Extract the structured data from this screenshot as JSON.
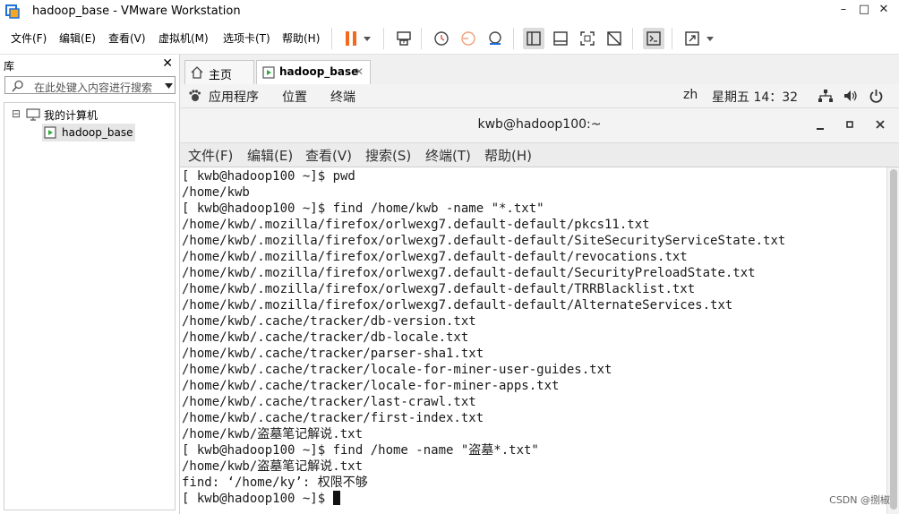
{
  "window": {
    "title": "hadoop_base - VMware Workstation",
    "controls": {
      "minimize": "–",
      "maximize": "□",
      "close": "✕"
    }
  },
  "menubar": {
    "items": [
      "文件(F)",
      "编辑(E)",
      "查看(V)",
      "虚拟机(M)",
      "选项卡(T)",
      "帮助(H)"
    ]
  },
  "library": {
    "title": "库",
    "close": "✕",
    "search_placeholder": "在此处键入内容进行搜索",
    "tree": {
      "root": "我的计算机",
      "expander": "⊟",
      "child": "hadoop_base"
    }
  },
  "tabs": [
    {
      "label": "主页",
      "icon": "home-icon"
    },
    {
      "label": "hadoop_base",
      "icon": "vm-running-icon",
      "close": "✕",
      "active": true
    }
  ],
  "gnome_panel": {
    "applications": "应用程序",
    "places": "位置",
    "terminal": "终端",
    "lang": "zh",
    "clock": "星期五 14：32"
  },
  "terminal": {
    "title": "kwb@hadoop100:~",
    "menu": [
      "文件(F)",
      "编辑(E)",
      "查看(V)",
      "搜索(S)",
      "终端(T)",
      "帮助(H)"
    ],
    "lines": [
      "[ kwb@hadoop100 ~]$ pwd",
      "/home/kwb",
      "[ kwb@hadoop100 ~]$ find /home/kwb -name \"*.txt\"",
      "/home/kwb/.mozilla/firefox/orlwexg7.default-default/pkcs11.txt",
      "/home/kwb/.mozilla/firefox/orlwexg7.default-default/SiteSecurityServiceState.txt",
      "/home/kwb/.mozilla/firefox/orlwexg7.default-default/revocations.txt",
      "/home/kwb/.mozilla/firefox/orlwexg7.default-default/SecurityPreloadState.txt",
      "/home/kwb/.mozilla/firefox/orlwexg7.default-default/TRRBlacklist.txt",
      "/home/kwb/.mozilla/firefox/orlwexg7.default-default/AlternateServices.txt",
      "/home/kwb/.cache/tracker/db-version.txt",
      "/home/kwb/.cache/tracker/db-locale.txt",
      "/home/kwb/.cache/tracker/parser-sha1.txt",
      "/home/kwb/.cache/tracker/locale-for-miner-user-guides.txt",
      "/home/kwb/.cache/tracker/locale-for-miner-apps.txt",
      "/home/kwb/.cache/tracker/last-crawl.txt",
      "/home/kwb/.cache/tracker/first-index.txt",
      "/home/kwb/盗墓笔记解说.txt",
      "[ kwb@hadoop100 ~]$ find /home -name \"盗墓*.txt\"",
      "/home/kwb/盗墓笔记解说.txt",
      "find: ‘/home/ky’: 权限不够",
      "[ kwb@hadoop100 ~]$ "
    ]
  },
  "watermark": "CSDN @捌椒",
  "colors": {
    "pause_accent": "#f26b1d",
    "accent_blue": "#1e6fd9"
  }
}
